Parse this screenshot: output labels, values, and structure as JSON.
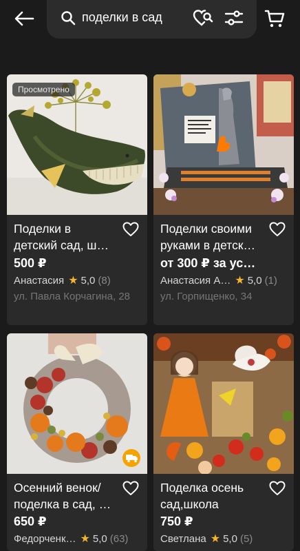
{
  "search": {
    "query": "поделки в сад"
  },
  "products": [
    {
      "title": "Поделки в\nдетский сад, ш…",
      "price": "500 ₽",
      "seller": "Анастасия",
      "rating": "5,0",
      "reviews": "(8)",
      "address": "ул. Павла Корчагина, 28",
      "badge": "Просмотрено"
    },
    {
      "title": "Поделки своими\nруками в детск…",
      "price": "от 300 ₽ за ус…",
      "seller": "Анастасия А…",
      "rating": "5,0",
      "reviews": "(1)",
      "address": "ул. Горпищенко, 34"
    },
    {
      "title": "Осенний венок/\nподелка в сад, …",
      "price": "650 ₽",
      "seller": "Федорченк…",
      "rating": "5,0",
      "reviews": "(63)"
    },
    {
      "title": "Поделка осень\nсад,школа",
      "price": "750 ₽",
      "seller": "Светлана",
      "rating": "5,0",
      "reviews": "(5)"
    }
  ],
  "colors": {
    "background": "#1b1b1b",
    "card": "#2a2a2a",
    "star": "#f5b52e",
    "delivery": "#f5a300"
  },
  "icons": [
    "arrow-left-icon",
    "search-icon",
    "heart-search-icon",
    "filter-sliders-icon",
    "cart-icon",
    "heart-icon",
    "star-icon",
    "delivery-truck-icon"
  ]
}
